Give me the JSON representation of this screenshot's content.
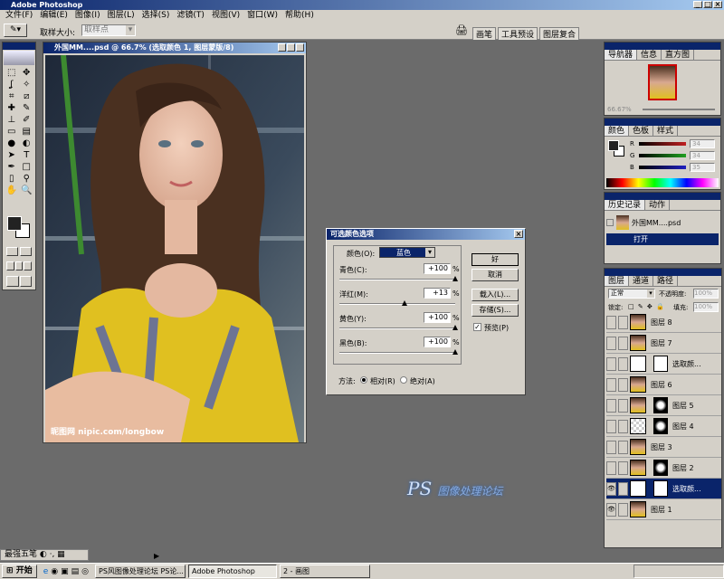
{
  "app": {
    "title": "Adobe Photoshop"
  },
  "menu": [
    "文件(F)",
    "编辑(E)",
    "图像(I)",
    "图层(L)",
    "选择(S)",
    "滤镜(T)",
    "视图(V)",
    "窗口(W)",
    "帮助(H)"
  ],
  "options": {
    "sample_label": "取样大小:",
    "sample_value": "取样点"
  },
  "dock_tabs": [
    "画笔",
    "工具预设",
    "图层复合"
  ],
  "doc": {
    "title": "外国MM....psd @ 66.7% (选取颜色 1, 图层蒙版/8)",
    "watermark": "昵图网 nipic.com/longbow"
  },
  "dialog": {
    "title": "可选颜色选项",
    "color_label": "颜色(O):",
    "color_value": "蓝色",
    "sliders": [
      {
        "label": "青色(C):",
        "value": "+100",
        "unit": "%",
        "pos": 1.0
      },
      {
        "label": "洋红(M):",
        "value": "+13",
        "unit": "%",
        "pos": 0.565
      },
      {
        "label": "黄色(Y):",
        "value": "+100",
        "unit": "%",
        "pos": 1.0
      },
      {
        "label": "黑色(B):",
        "value": "+100",
        "unit": "%",
        "pos": 1.0
      }
    ],
    "buttons": {
      "ok": "好",
      "cancel": "取消",
      "load": "载入(L)...",
      "save": "存储(S)..."
    },
    "preview": "预览(P)",
    "method_label": "方法:",
    "relative": "相对(R)",
    "absolute": "绝对(A)"
  },
  "navigator": {
    "tabs": [
      "导航器",
      "信息",
      "直方图"
    ],
    "zoom": "66.67%"
  },
  "color_panel": {
    "tabs": [
      "颜色",
      "色板",
      "样式"
    ],
    "r_label": "R",
    "g_label": "G",
    "b_label": "B",
    "r": "34",
    "g": "34",
    "b": "35"
  },
  "history": {
    "tabs": [
      "历史记录",
      "动作"
    ],
    "doc_name": "外国MM....psd",
    "items": [
      "打开"
    ]
  },
  "layers": {
    "tabs": [
      "图层",
      "通道",
      "路径"
    ],
    "blend": "正常",
    "opacity_label": "不透明度:",
    "opacity": "100%",
    "lock_label": "锁定:",
    "fill_label": "填充:",
    "fill": "100%",
    "items": [
      {
        "name": "图层 8",
        "type": "photo",
        "visible": false,
        "selected": false
      },
      {
        "name": "图层 7",
        "type": "photo",
        "visible": false,
        "selected": false
      },
      {
        "name": "选取颜...",
        "type": "adjust",
        "visible": false,
        "selected": false
      },
      {
        "name": "图层 6",
        "type": "photo",
        "visible": false,
        "selected": false
      },
      {
        "name": "图层 5",
        "type": "masked",
        "visible": false,
        "selected": false
      },
      {
        "name": "图层 4",
        "type": "masked-trans",
        "visible": false,
        "selected": false
      },
      {
        "name": "图层 3",
        "type": "photo",
        "visible": false,
        "selected": false
      },
      {
        "name": "图层 2",
        "type": "masked",
        "visible": false,
        "selected": false
      },
      {
        "name": "选取颜...",
        "type": "adjust",
        "visible": true,
        "selected": true
      },
      {
        "name": "图层 1",
        "type": "photo",
        "visible": true,
        "selected": false
      }
    ]
  },
  "taskbar": {
    "start": "开始",
    "items": [
      "PS风图像处理论坛 PS论...",
      "Adobe Photoshop",
      "2 - 画图"
    ],
    "ime": "最强五笔"
  },
  "colors": {
    "selection": "#0a246a",
    "accent_yellow": "#e0c020",
    "dress_blue": "#5060b0"
  }
}
